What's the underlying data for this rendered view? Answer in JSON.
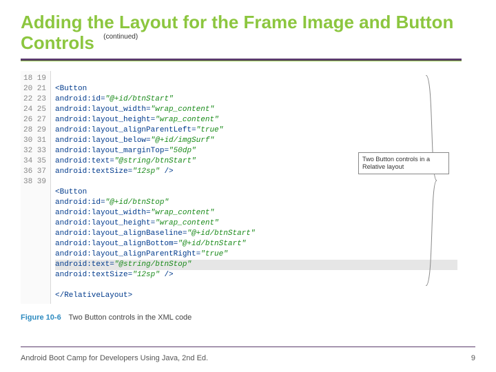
{
  "title": "Adding the Layout for the Frame Image and Button Controls",
  "continued": "(continued)",
  "lineStart": 18,
  "lineEnd": 39,
  "code": {
    "l18": "",
    "l19_tag": "<Button",
    "l20": "android:id",
    "l20v": "\"@+id/btnStart\"",
    "l21": "android:layout_width",
    "l21v": "\"wrap_content\"",
    "l22": "android:layout_height",
    "l22v": "\"wrap_content\"",
    "l23": "android:layout_alignParentLeft",
    "l23v": "\"true\"",
    "l24": "android:layout_below",
    "l24v": "\"@+id/imgSurf\"",
    "l25": "android:layout_marginTop",
    "l25v": "\"50dp\"",
    "l26": "android:text",
    "l26v": "\"@string/btnStart\"",
    "l27": "android:textSize",
    "l27v": "\"12sp\"",
    "l27_end": "/>",
    "l28": "",
    "l29_tag": "<Button",
    "l30": "android:id",
    "l30v": "\"@+id/btnStop\"",
    "l31": "android:layout_width",
    "l31v": "\"wrap_content\"",
    "l32": "android:layout_height",
    "l32v": "\"wrap_content\"",
    "l33": "android:layout_alignBaseline",
    "l33v": "\"@+id/btnStart\"",
    "l34": "android:layout_alignBottom",
    "l34v": "\"@+id/btnStart\"",
    "l35": "android:layout_alignParentRight",
    "l35v": "\"true\"",
    "l36": "android:text",
    "l36v": "\"@string/btnStop\"",
    "l37": "android:textSize",
    "l37v": "\"12sp\"",
    "l37_end": "/>",
    "l38": "",
    "l39_close": "</RelativeLayout>"
  },
  "callout": "Two Button controls in a Relative layout",
  "figure_num": "Figure 10-6",
  "figure_caption": "Two Button controls in the XML code",
  "footer_left": "Android Boot Camp for Developers Using Java, 2nd Ed.",
  "page_num": "9"
}
